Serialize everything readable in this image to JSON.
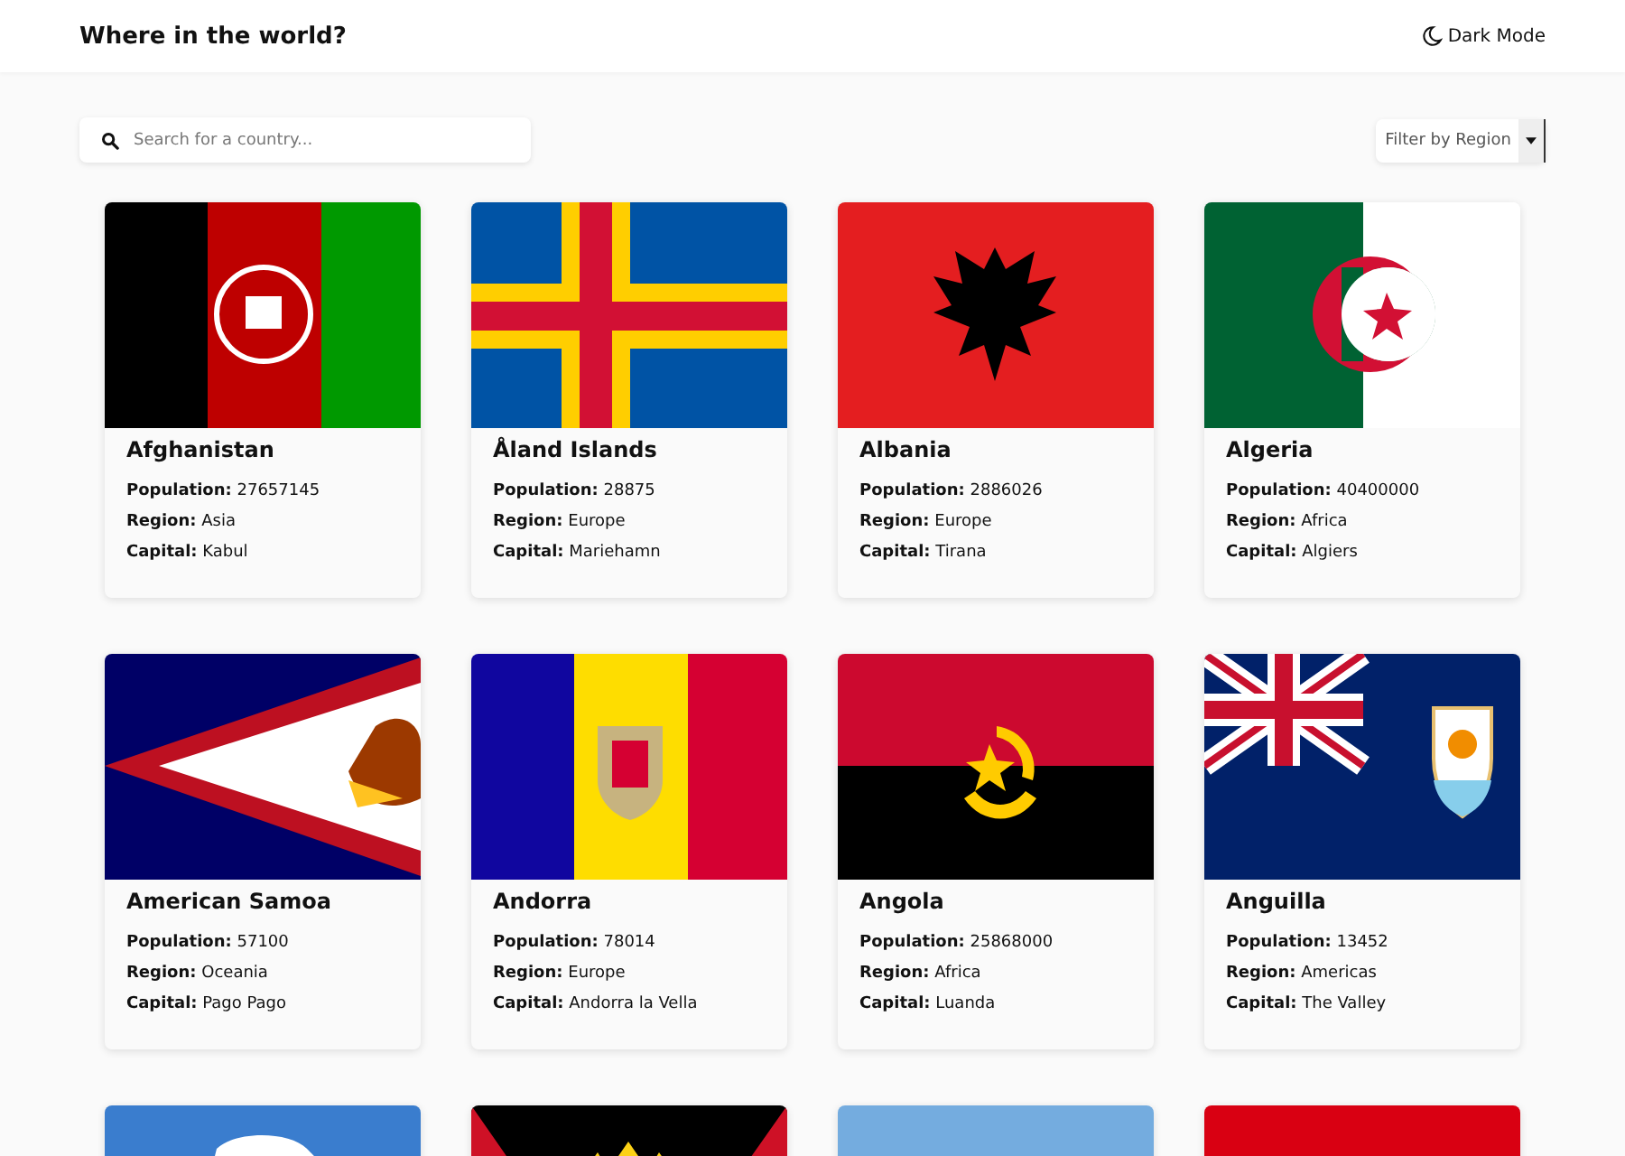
{
  "header": {
    "title": "Where in the world?",
    "theme_toggle": "Dark Mode"
  },
  "search": {
    "placeholder": "Search for a country..."
  },
  "filter": {
    "label": "Filter by Region"
  },
  "countries": [
    {
      "name": "Afghanistan",
      "population_label": "Population:",
      "population": "27657145",
      "region_label": "Region:",
      "region": "Asia",
      "capital_label": "Capital:",
      "capital": "Kabul"
    },
    {
      "name": "Åland Islands",
      "population_label": "Population:",
      "population": "28875",
      "region_label": "Region:",
      "region": "Europe",
      "capital_label": "Capital:",
      "capital": "Mariehamn"
    },
    {
      "name": "Albania",
      "population_label": "Population:",
      "population": "2886026",
      "region_label": "Region:",
      "region": "Europe",
      "capital_label": "Capital:",
      "capital": "Tirana"
    },
    {
      "name": "Algeria",
      "population_label": "Population:",
      "population": "40400000",
      "region_label": "Region:",
      "region": "Africa",
      "capital_label": "Capital:",
      "capital": "Algiers"
    },
    {
      "name": "American Samoa",
      "population_label": "Population:",
      "population": "57100",
      "region_label": "Region:",
      "region": "Oceania",
      "capital_label": "Capital:",
      "capital": "Pago Pago"
    },
    {
      "name": "Andorra",
      "population_label": "Population:",
      "population": "78014",
      "region_label": "Region:",
      "region": "Europe",
      "capital_label": "Capital:",
      "capital": "Andorra la Vella"
    },
    {
      "name": "Angola",
      "population_label": "Population:",
      "population": "25868000",
      "region_label": "Region:",
      "region": "Africa",
      "capital_label": "Capital:",
      "capital": "Luanda"
    },
    {
      "name": "Anguilla",
      "population_label": "Population:",
      "population": "13452",
      "region_label": "Region:",
      "region": "Americas",
      "capital_label": "Capital:",
      "capital": "The Valley"
    }
  ]
}
